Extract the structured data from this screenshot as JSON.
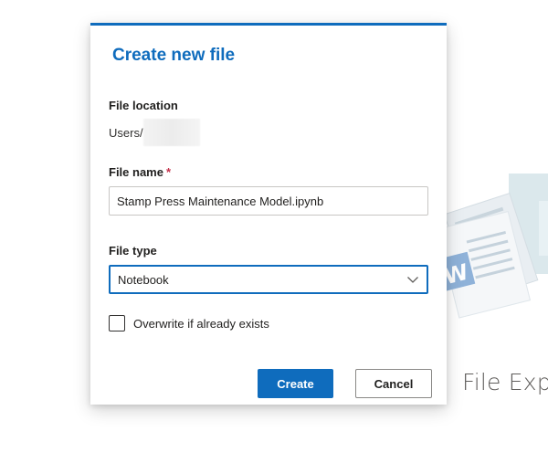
{
  "dialog": {
    "title": "Create new file",
    "file_location": {
      "label": "File location",
      "path_prefix": "Users/"
    },
    "file_name": {
      "label": "File name",
      "required_mark": "*",
      "value": "Stamp Press Maintenance Model.ipynb"
    },
    "file_type": {
      "label": "File type",
      "selected": "Notebook"
    },
    "overwrite": {
      "label": "Overwrite if already exists",
      "checked": false
    },
    "buttons": {
      "create": "Create",
      "cancel": "Cancel"
    }
  },
  "background": {
    "caption": "File Expl"
  },
  "colors": {
    "accent": "#0f6cbd",
    "required": "#c4314b"
  }
}
